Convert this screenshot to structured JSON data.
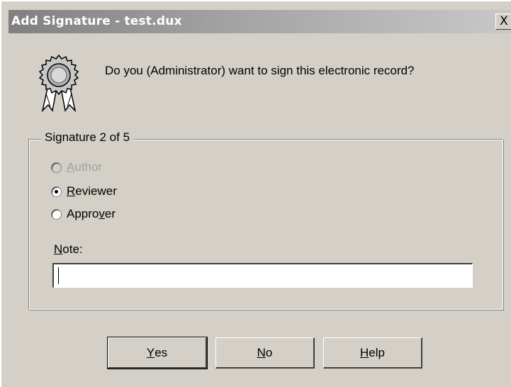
{
  "window": {
    "title": "Add Signature - test.dux",
    "close_label": "X"
  },
  "prompt": "Do you (Administrator) want to sign this electronic record?",
  "signature_group": {
    "label": "Signature 2 of 5",
    "options": [
      {
        "label": "Author",
        "mnemonic": "A",
        "rest": "uthor",
        "enabled": false,
        "checked": false
      },
      {
        "label": "Reviewer",
        "mnemonic": "R",
        "rest": "eviewer",
        "enabled": true,
        "checked": true
      },
      {
        "label": "Approver",
        "prefix": "Appro",
        "mnemonic": "v",
        "rest": "er",
        "enabled": true,
        "checked": false
      }
    ]
  },
  "note": {
    "label_mnemonic": "N",
    "label_rest": "ote:",
    "value": ""
  },
  "buttons": {
    "yes": {
      "mnemonic": "Y",
      "rest": "es"
    },
    "no": {
      "mnemonic": "N",
      "rest": "o"
    },
    "help": {
      "mnemonic": "H",
      "rest": "elp"
    }
  },
  "icon": "ribbon-seal-icon"
}
